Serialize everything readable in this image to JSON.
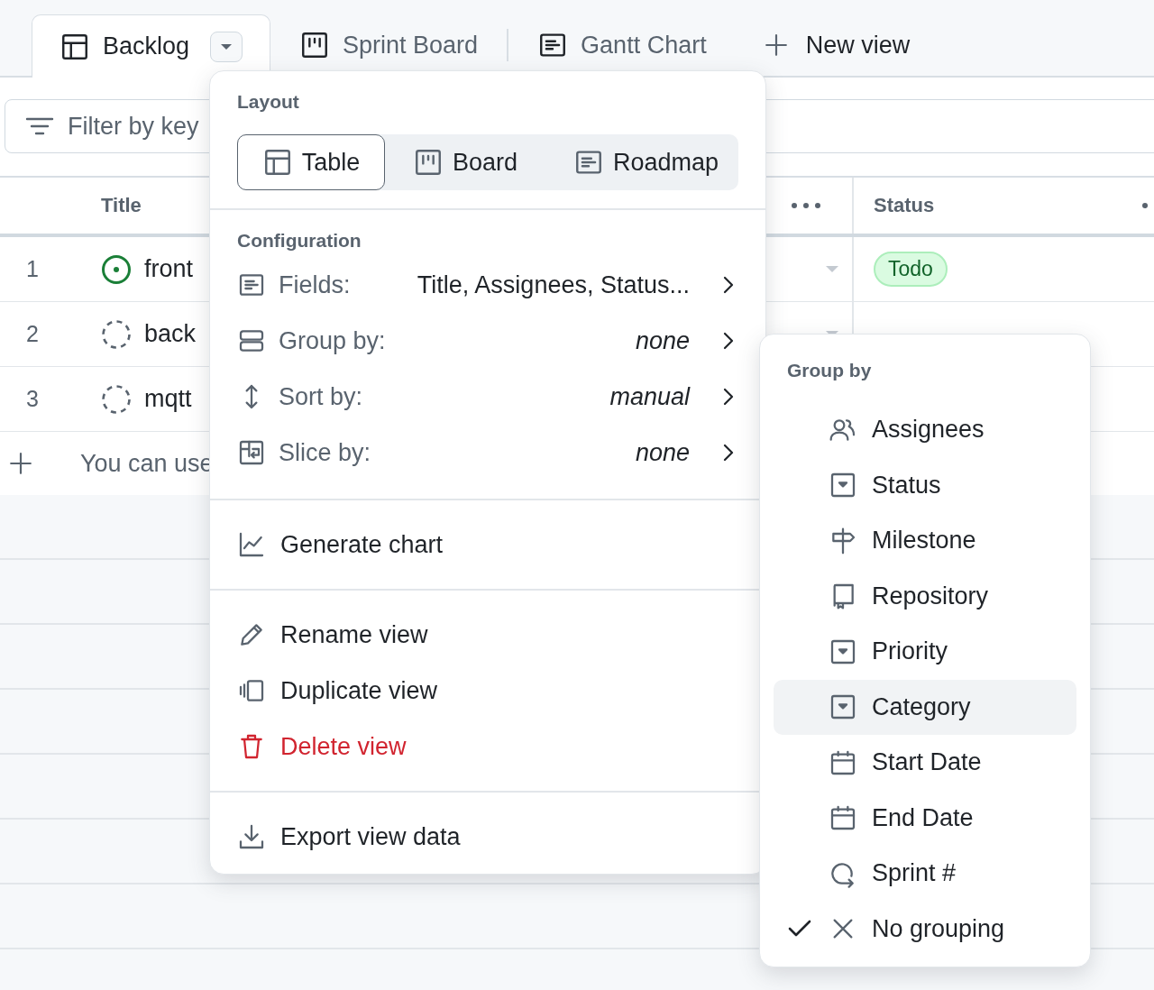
{
  "tabs": [
    {
      "label": "Backlog",
      "selected": true
    },
    {
      "label": "Sprint Board",
      "selected": false
    },
    {
      "label": "Gantt Chart",
      "selected": false
    }
  ],
  "new_view": {
    "label": "New view"
  },
  "filter": {
    "placeholder": "Filter by key"
  },
  "table": {
    "columns": [
      {
        "label": "Title"
      },
      {
        "label": "Status"
      }
    ],
    "rows": [
      {
        "number": "1",
        "kind": "issue",
        "title": "front",
        "status": "Todo"
      },
      {
        "number": "2",
        "kind": "draft",
        "title": "back"
      },
      {
        "number": "3",
        "kind": "draft",
        "title": "mqtt"
      }
    ],
    "add_row": {
      "hint": "You can use"
    }
  },
  "view_menu": {
    "layout_label": "Layout",
    "layouts": [
      {
        "label": "Table",
        "selected": true
      },
      {
        "label": "Board",
        "selected": false
      },
      {
        "label": "Roadmap",
        "selected": false
      }
    ],
    "configuration_label": "Configuration",
    "config": [
      {
        "label": "Fields:",
        "value": "Title, Assignees, Status...",
        "is_default": false
      },
      {
        "label": "Group by:",
        "value": "none",
        "is_default": true
      },
      {
        "label": "Sort by:",
        "value": "manual",
        "is_default": true
      },
      {
        "label": "Slice by:",
        "value": "none",
        "is_default": true
      }
    ],
    "action_groups": [
      [
        {
          "label": "Generate chart",
          "danger": false
        }
      ],
      [
        {
          "label": "Rename view",
          "danger": false
        },
        {
          "label": "Duplicate view",
          "danger": false
        },
        {
          "label": "Delete view",
          "danger": true
        }
      ],
      [
        {
          "label": "Export view data",
          "danger": false
        }
      ]
    ]
  },
  "group_menu": {
    "title": "Group by",
    "items": [
      {
        "label": "Assignees",
        "highlighted": false,
        "checked": false
      },
      {
        "label": "Status",
        "highlighted": false,
        "checked": false
      },
      {
        "label": "Milestone",
        "highlighted": false,
        "checked": false
      },
      {
        "label": "Repository",
        "highlighted": false,
        "checked": false
      },
      {
        "label": "Priority",
        "highlighted": false,
        "checked": false
      },
      {
        "label": "Category",
        "highlighted": true,
        "checked": false
      },
      {
        "label": "Start Date",
        "highlighted": false,
        "checked": false
      },
      {
        "label": "End Date",
        "highlighted": false,
        "checked": false
      },
      {
        "label": "Sprint #",
        "highlighted": false,
        "checked": false
      },
      {
        "label": "No grouping",
        "highlighted": false,
        "checked": true
      }
    ]
  }
}
